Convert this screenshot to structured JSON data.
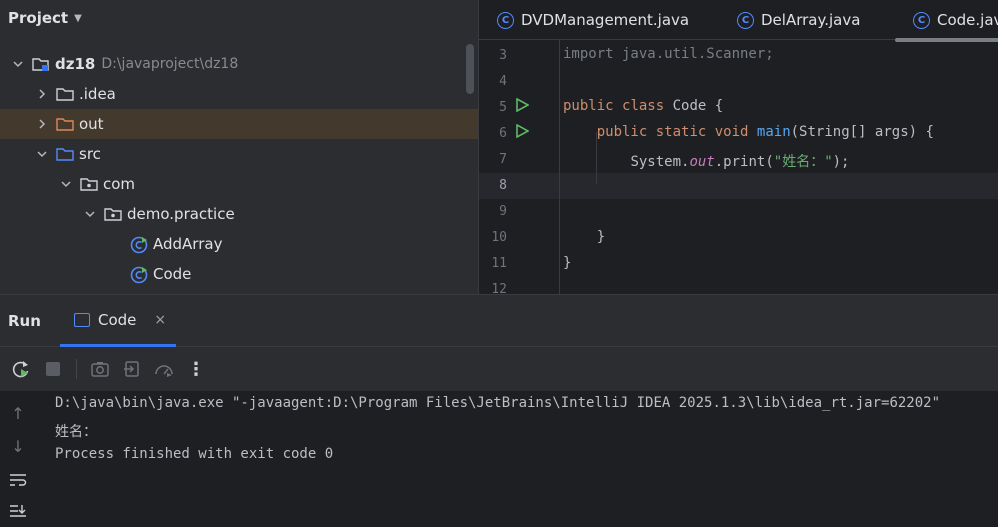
{
  "project": {
    "title": "Project",
    "tree": [
      {
        "label": "dz18",
        "path": "D:\\javaproject\\dz18",
        "icon": "module-folder-icon",
        "expanded": true
      },
      {
        "label": ".idea",
        "icon": "folder-icon",
        "expanded": false
      },
      {
        "label": "out",
        "icon": "excluded-folder-icon",
        "expanded": false
      },
      {
        "label": "src",
        "icon": "source-folder-icon",
        "expanded": true
      },
      {
        "label": "com",
        "icon": "package-icon",
        "expanded": true
      },
      {
        "label": "demo.practice",
        "icon": "package-icon",
        "expanded": true
      },
      {
        "label": "AddArray",
        "icon": "java-class-icon"
      },
      {
        "label": "Code",
        "icon": "java-class-icon"
      }
    ]
  },
  "editor": {
    "tabs": [
      {
        "label": "DVDManagement.java",
        "icon": "class-icon"
      },
      {
        "label": "DelArray.java",
        "icon": "class-icon"
      },
      {
        "label": "Code.jav",
        "icon": "class-icon"
      }
    ],
    "line_numbers": [
      "3",
      "4",
      "5",
      "6",
      "7",
      "8",
      "9",
      "10",
      "11",
      "12"
    ],
    "code": {
      "l3": "import java.util.Scanner;",
      "l5_kw1": "public",
      "l5_kw2": "class",
      "l5_name": "Code {",
      "l6_kw1": "public",
      "l6_kw2": "static",
      "l6_kw3": "void",
      "l6_fn": "main",
      "l6_rest": "(String[] args) {",
      "l7_obj": "System.",
      "l7_field": "out",
      "l7_call": ".print(",
      "l7_str": "\"姓名：\"",
      "l7_end": ");",
      "l10": "}",
      "l11": "}"
    }
  },
  "run": {
    "title": "Run",
    "tab_label": "Code",
    "close": "×",
    "console": [
      "D:\\java\\bin\\java.exe \"-javaagent:D:\\Program Files\\JetBrains\\IntelliJ IDEA 2025.1.3\\lib\\idea_rt.jar=62202\"",
      "姓名：",
      "Process finished with exit code 0"
    ]
  },
  "colors": {
    "accent": "#3574f0",
    "keyword": "#cf8e6d",
    "function": "#56a8f5",
    "string": "#6aab73",
    "field": "#c77dbb",
    "run_green": "#5fb865"
  }
}
